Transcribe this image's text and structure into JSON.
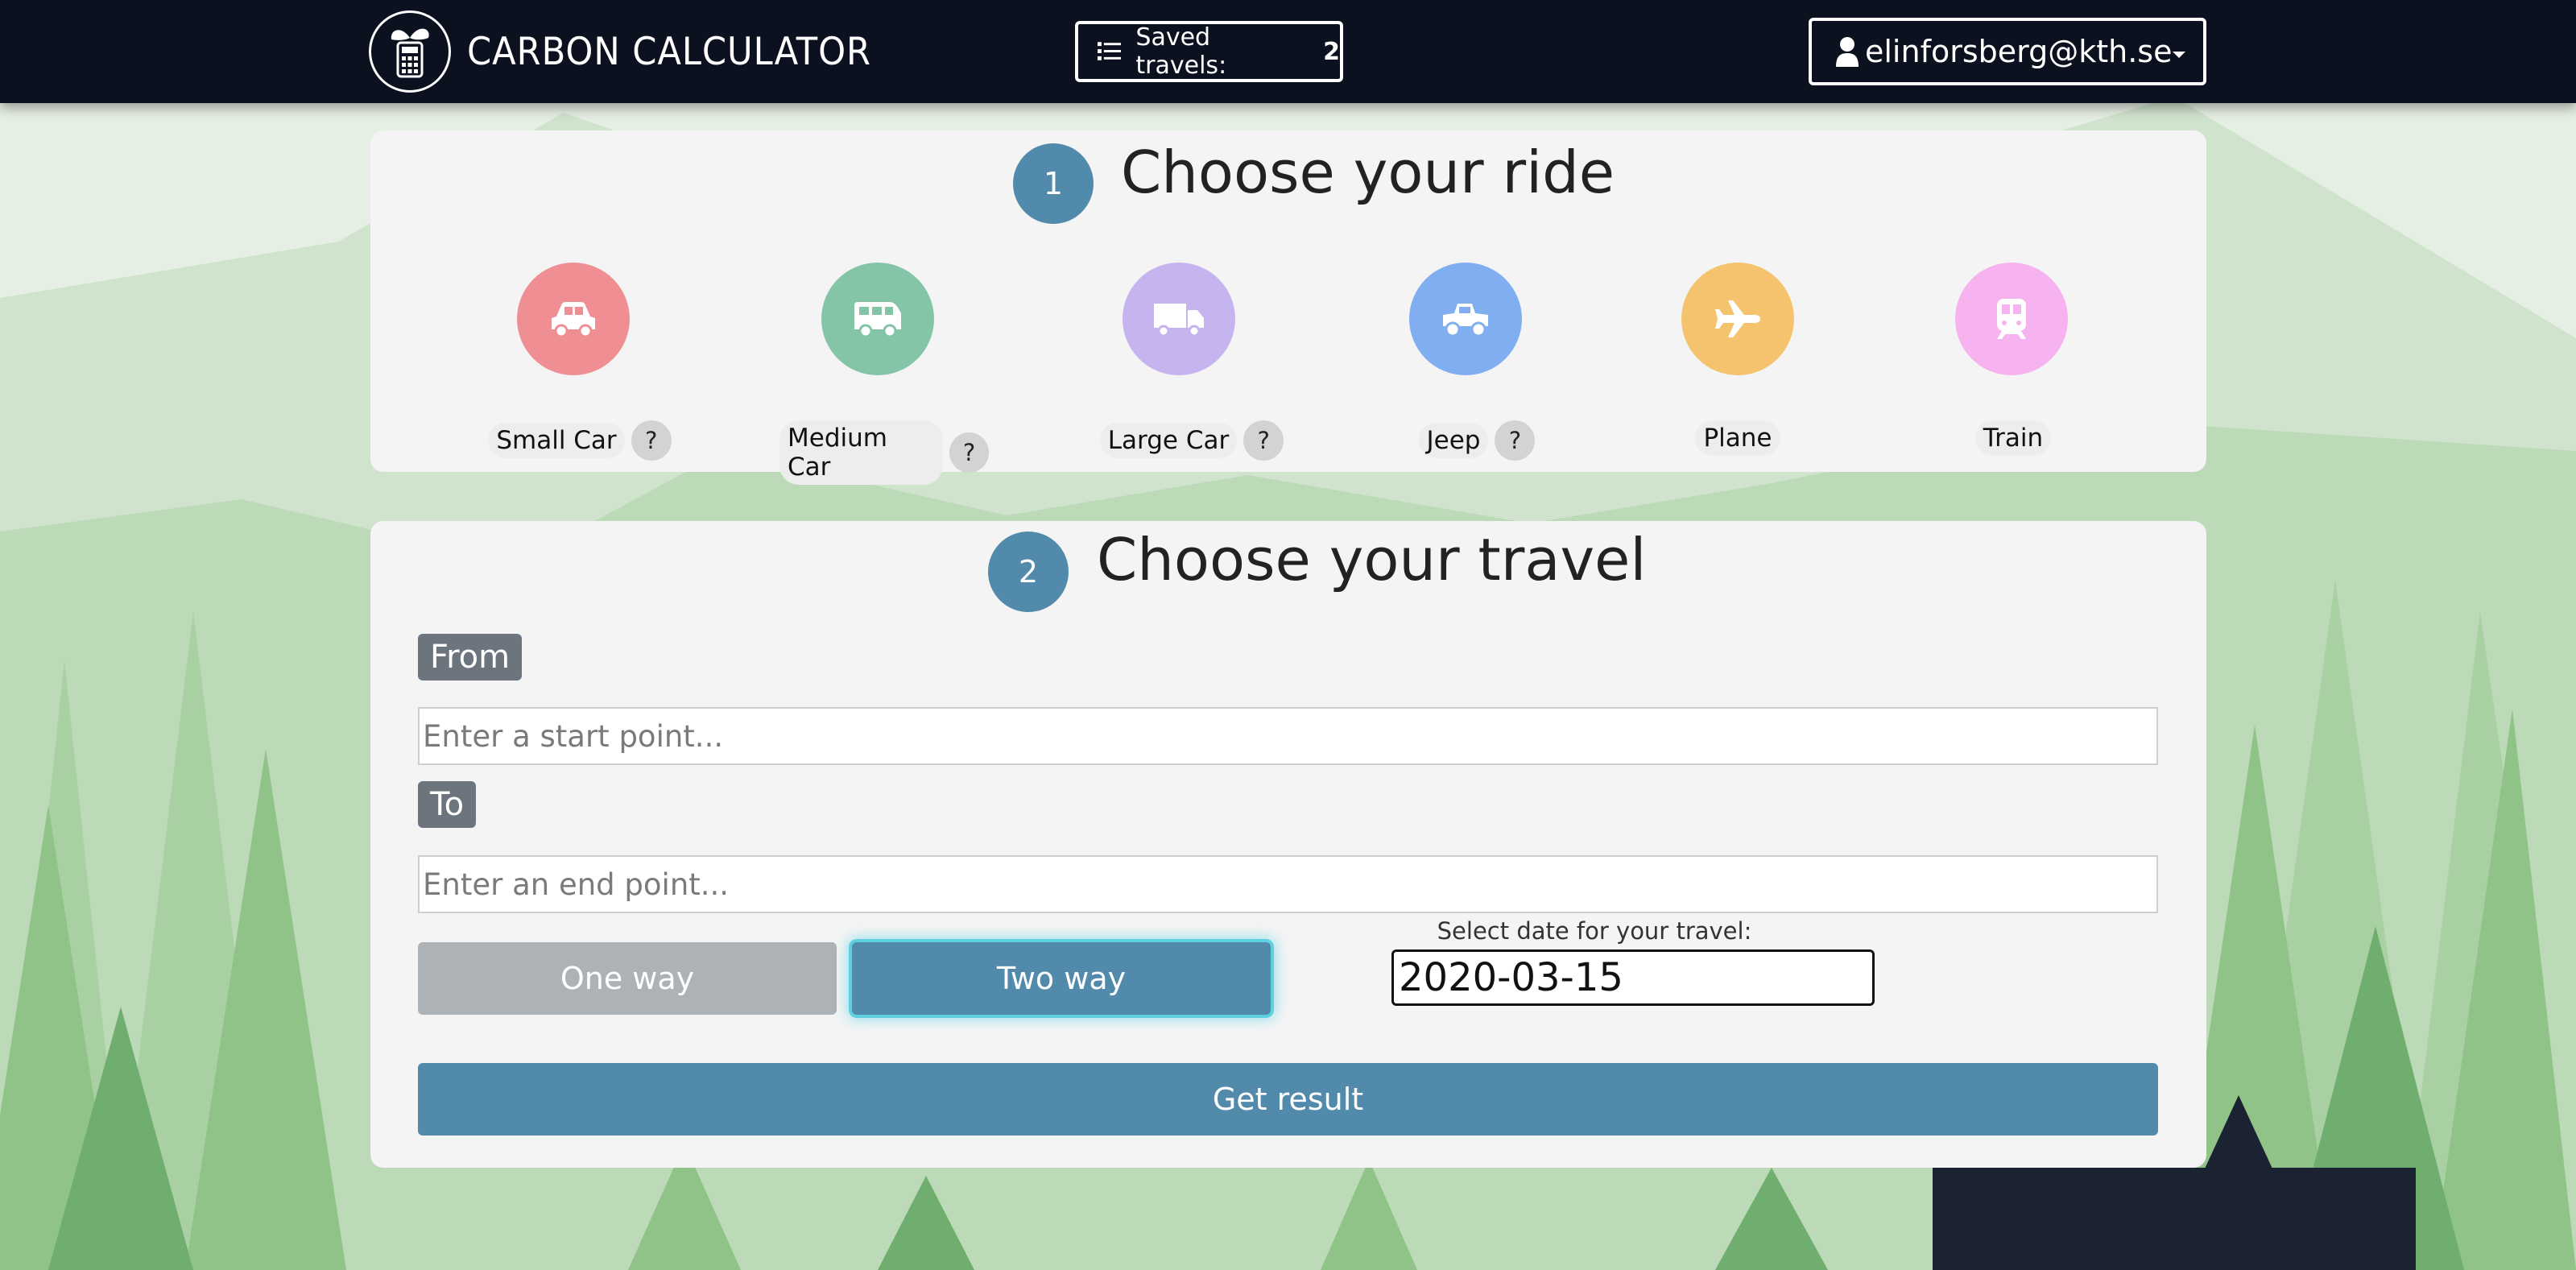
{
  "app": {
    "title": "CARBON CALCULATOR"
  },
  "navbar": {
    "saved_label": "Saved travels:",
    "saved_count": "2",
    "user_email": "elinforsberg@kth.se"
  },
  "step1": {
    "number": "1",
    "title": "Choose your ride",
    "vehicles": [
      {
        "label": "Small Car",
        "help": "?",
        "icon": "car-icon",
        "color": "#ef8f93"
      },
      {
        "label": "Medium Car",
        "help": "?",
        "icon": "van-icon",
        "color": "#84c5a8"
      },
      {
        "label": "Large Car",
        "help": "?",
        "icon": "truck-icon",
        "color": "#c6b4ee"
      },
      {
        "label": "Jeep",
        "help": "?",
        "icon": "jeep-icon",
        "color": "#80aef0"
      },
      {
        "label": "Plane",
        "icon": "plane-icon",
        "color": "#f5c36d"
      },
      {
        "label": "Train",
        "icon": "train-icon",
        "color": "#f6b3ef"
      }
    ]
  },
  "step2": {
    "number": "2",
    "title": "Choose your travel",
    "from_label": "From",
    "from_placeholder": "Enter a start point...",
    "to_label": "To",
    "to_placeholder": "Enter an end point...",
    "one_way": "One way",
    "two_way": "Two way",
    "date_label": "Select date for your travel:",
    "date_value": "2020-03-15",
    "submit": "Get result"
  },
  "colors": {
    "navbar": "#0c1120",
    "accent": "#528aab",
    "card": "#f4f4f4"
  }
}
